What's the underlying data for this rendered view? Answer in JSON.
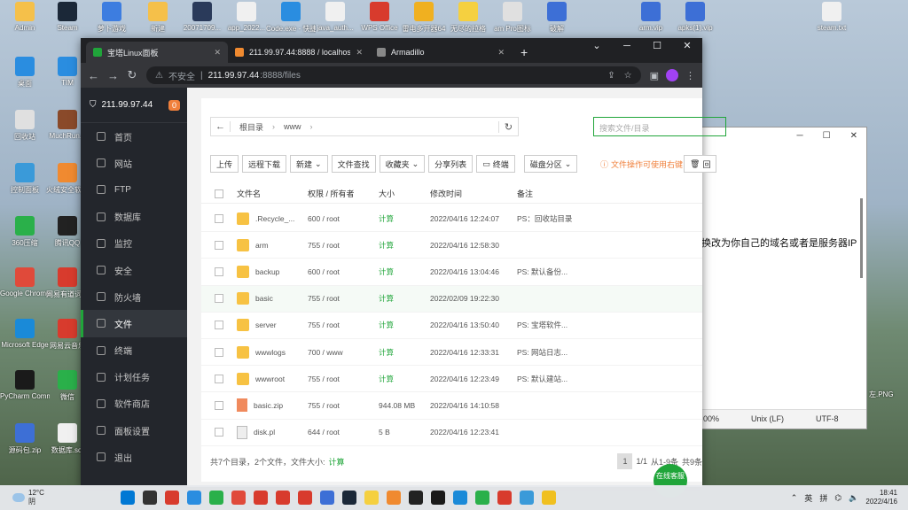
{
  "desktop_icons": [
    {
      "label": "Admin",
      "color": "#f5c04a"
    },
    {
      "label": "Steam",
      "color": "#1b2838"
    },
    {
      "label": "萝卜游戏",
      "color": "#3d7de0"
    },
    {
      "label": "新建",
      "color": "#f5c04a"
    },
    {
      "label": "20071709...",
      "color": "#2a3a5a"
    },
    {
      "label": "app_2022...",
      "color": "#f0f0f0"
    },
    {
      "label": "Code.exe - 快捷方式",
      "color": "#2a8de0"
    },
    {
      "label": "java_auth...",
      "color": "#f0f0f0"
    },
    {
      "label": "WPS Office",
      "color": "#d83b2d"
    },
    {
      "label": "雷电多开器64",
      "color": "#f0b020"
    },
    {
      "label": "无尽的拉格",
      "color": "#f5d040"
    },
    {
      "label": "am Pro图标",
      "color": "#e0e0e0"
    },
    {
      "label": "破解",
      "color": "#3d6fd6"
    },
    {
      "label": "arm.vip",
      "color": "#3d6fd6"
    },
    {
      "label": "apks(1).vip",
      "color": "#3d6fd6"
    },
    {
      "label": "steam.txt",
      "color": "#f0f0f0"
    },
    {
      "label": "桌面",
      "color": "#2a8de0"
    },
    {
      "label": "TIM",
      "color": "#2a8de0"
    },
    {
      "label": "回收站",
      "color": "#e0e0e0"
    },
    {
      "label": "MuchRun...",
      "color": "#8a4a2a"
    },
    {
      "label": "控制面板",
      "color": "#3a9ad9"
    },
    {
      "label": "火绒安全软件",
      "color": "#f08a30"
    },
    {
      "label": "360压缩",
      "color": "#2ab04a"
    },
    {
      "label": "腾讯QQ",
      "color": "#222"
    },
    {
      "label": "Google Chrome",
      "color": "#e04a3a"
    },
    {
      "label": "网易有道词典",
      "color": "#d83b2d"
    },
    {
      "label": "Microsoft Edge",
      "color": "#1a8ad8"
    },
    {
      "label": "网易云音乐",
      "color": "#d83b2d"
    },
    {
      "label": "PyCharm Communi...",
      "color": "#1a1a1a"
    },
    {
      "label": "微信",
      "color": "#2ab04a"
    },
    {
      "label": "源码包.zip",
      "color": "#3d6fd6"
    },
    {
      "label": "数据库.sql",
      "color": "#f0f0f0"
    }
  ],
  "notepad": {
    "text": "换改为你自己的域名或者是服务器IP",
    "status_zoom": "00%",
    "status_eol": "Unix (LF)",
    "status_enc": "UTF-8",
    "min": "─",
    "max": "☐",
    "close": "✕",
    "side_label": "左.PNG"
  },
  "browser": {
    "tabs": [
      {
        "title": "宝塔Linux面板",
        "color": "#20a53a"
      },
      {
        "title": "211.99.97.44:8888 / localhost /",
        "color": "#f08a30"
      },
      {
        "title": "Armadillo",
        "color": "#4a4a4a"
      }
    ],
    "new_tab": "+",
    "window_controls": [
      "⌄",
      "─",
      "☐",
      "✕"
    ],
    "insecure_label": "不安全",
    "url_host": "211.99.97.44",
    "url_path": ":8888/files"
  },
  "panel": {
    "server_ip": "211.99.97.44",
    "badge": "0",
    "menu": [
      "首页",
      "网站",
      "FTP",
      "数据库",
      "监控",
      "安全",
      "防火墙",
      "文件",
      "终端",
      "计划任务",
      "软件商店",
      "面板设置",
      "退出"
    ],
    "active_menu": "文件"
  },
  "files": {
    "breadcrumb": [
      "根目录",
      "www"
    ],
    "search_placeholder": "搜索文件/目录",
    "toolbar": [
      "上传",
      "远程下载",
      "新建",
      "文件查找",
      "收藏夹",
      "分享列表",
      "终端",
      "磁盘分区"
    ],
    "tip": "文件操作可使用右键",
    "trash_label": "回",
    "headers": [
      "文件名",
      "权限 / 所有者",
      "大小",
      "修改时间",
      "备注"
    ],
    "rows": [
      {
        "name": ".Recycle_...",
        "perm": "600 / root",
        "size": "计算",
        "time": "2022/04/16 12:24:07",
        "note": "PS：回收站目录",
        "type": "folder"
      },
      {
        "name": "arm",
        "perm": "755 / root",
        "size": "计算",
        "time": "2022/04/16 12:58:30",
        "note": "",
        "type": "folder"
      },
      {
        "name": "backup",
        "perm": "600 / root",
        "size": "计算",
        "time": "2022/04/16 13:04:46",
        "note": "PS: 默认备份...",
        "type": "folder"
      },
      {
        "name": "basic",
        "perm": "755 / root",
        "size": "计算",
        "time": "2022/02/09 19:22:30",
        "note": "",
        "type": "folder"
      },
      {
        "name": "server",
        "perm": "755 / root",
        "size": "计算",
        "time": "2022/04/16 13:50:40",
        "note": "PS: 宝塔软件...",
        "type": "folder"
      },
      {
        "name": "wwwlogs",
        "perm": "700 / www",
        "size": "计算",
        "time": "2022/04/16 12:33:31",
        "note": "PS: 网站日志...",
        "type": "folder"
      },
      {
        "name": "wwwroot",
        "perm": "755 / root",
        "size": "计算",
        "time": "2022/04/16 12:23:49",
        "note": "PS: 默认建站...",
        "type": "folder"
      },
      {
        "name": "basic.zip",
        "perm": "755 / root",
        "size": "944.08 MB",
        "time": "2022/04/16 14:10:58",
        "note": "",
        "type": "zip"
      },
      {
        "name": "disk.pl",
        "perm": "644 / root",
        "size": "5 B",
        "time": "2022/04/16 12:23:41",
        "note": "",
        "type": "file"
      }
    ],
    "footer_summary": "共7个目录，2个文件，文件大小:",
    "footer_calc": "计算",
    "pager": [
      "1",
      "1/1",
      "从1-9条",
      "共9条"
    ],
    "online_help": "在线客服"
  },
  "taskbar": {
    "temp": "12°C",
    "weather": "阴",
    "tray_lang": "英",
    "tray_ime": "拼",
    "time": "18:41",
    "date": "2022/4/16",
    "icons": [
      "#0078d4",
      "#333",
      "#d83b2d",
      "#2a8de0",
      "#2ab04a",
      "#e04a3a",
      "#d83b2d",
      "#d83b2d",
      "#d83b2d",
      "#3d6fd6",
      "#1b2838",
      "#f5d040",
      "#f08a30",
      "#222",
      "#1a1a1a",
      "#1a8ad8",
      "#2ab04a",
      "#d83b2d",
      "#3a9ad9",
      "#f0c020"
    ]
  }
}
